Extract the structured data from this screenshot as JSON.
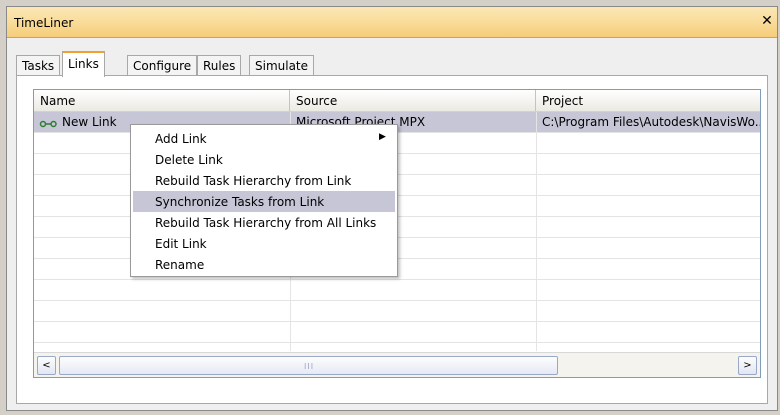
{
  "window": {
    "title": "TimeLiner",
    "close_glyph": "✕"
  },
  "tabs": [
    {
      "label": "Tasks",
      "active": false
    },
    {
      "label": "Links",
      "active": true
    },
    {
      "label": "Configure",
      "active": false
    },
    {
      "label": "Rules",
      "active": false
    },
    {
      "label": "Simulate",
      "active": false
    }
  ],
  "table": {
    "columns": [
      "Name",
      "Source",
      "Project"
    ],
    "rows": [
      {
        "name": "New Link",
        "source": "Microsoft Project MPX",
        "project": "C:\\Program Files\\Autodesk\\NavisWo...",
        "selected": true,
        "icon": "link-icon"
      }
    ],
    "empty_rows": 11
  },
  "scrollbar": {
    "left_arrow": "<",
    "right_arrow": ">",
    "grip": "III"
  },
  "context_menu": {
    "items": [
      {
        "label": "Add Link",
        "submenu": true,
        "highlighted": false
      },
      {
        "label": "Delete Link",
        "submenu": false,
        "highlighted": false
      },
      {
        "label": "Rebuild Task Hierarchy from Link",
        "submenu": false,
        "highlighted": false
      },
      {
        "label": "Synchronize Tasks from Link",
        "submenu": false,
        "highlighted": true
      },
      {
        "label": "Rebuild Task Hierarchy from All Links",
        "submenu": false,
        "highlighted": false
      },
      {
        "label": "Edit Link",
        "submenu": false,
        "highlighted": false
      },
      {
        "label": "Rename",
        "submenu": false,
        "highlighted": false
      }
    ],
    "submenu_arrow": "▶"
  },
  "colors": {
    "titlebar": "#f9db96",
    "selection": "#c6c6d6",
    "active_tab_accent": "#f0a030"
  }
}
